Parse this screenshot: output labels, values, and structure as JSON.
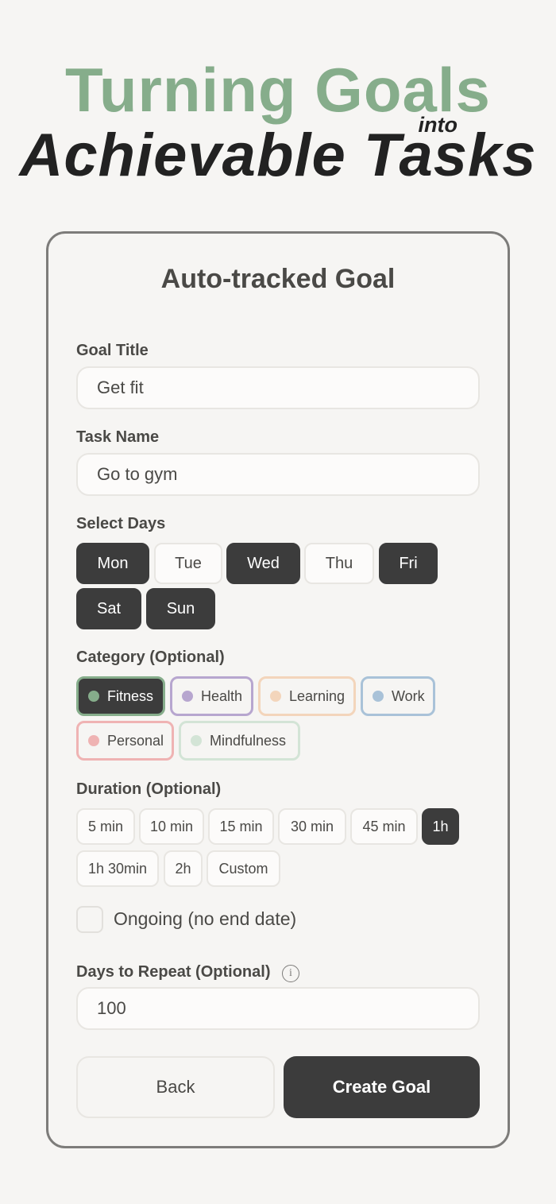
{
  "hero": {
    "line1": "Turning Goals",
    "into": "into",
    "line2": "Achievable Tasks"
  },
  "form": {
    "title": "Auto-tracked Goal",
    "goal_title": {
      "label": "Goal Title",
      "value": "Get fit"
    },
    "task_name": {
      "label": "Task Name",
      "value": "Go to gym"
    },
    "days": {
      "label": "Select Days",
      "items": [
        {
          "label": "Mon",
          "selected": true
        },
        {
          "label": "Tue",
          "selected": false
        },
        {
          "label": "Wed",
          "selected": true
        },
        {
          "label": "Thu",
          "selected": false
        },
        {
          "label": "Fri",
          "selected": true
        },
        {
          "label": "Sat",
          "selected": true
        },
        {
          "label": "Sun",
          "selected": true
        }
      ]
    },
    "category": {
      "label": "Category (Optional)",
      "items": [
        {
          "label": "Fitness",
          "color": "#86ad8b",
          "selected": true
        },
        {
          "label": "Health",
          "color": "#b7a6cf",
          "selected": false
        },
        {
          "label": "Learning",
          "color": "#f3d5bb",
          "selected": false
        },
        {
          "label": "Work",
          "color": "#a9c2d8",
          "selected": false
        },
        {
          "label": "Personal",
          "color": "#efb3b3",
          "selected": false
        },
        {
          "label": "Mindfulness",
          "color": "#d3e4d6",
          "selected": false
        }
      ]
    },
    "duration": {
      "label": "Duration (Optional)",
      "items": [
        {
          "label": "5 min",
          "selected": false
        },
        {
          "label": "10 min",
          "selected": false
        },
        {
          "label": "15 min",
          "selected": false
        },
        {
          "label": "30 min",
          "selected": false
        },
        {
          "label": "45 min",
          "selected": false
        },
        {
          "label": "1h",
          "selected": true
        },
        {
          "label": "1h 30min",
          "selected": false
        },
        {
          "label": "2h",
          "selected": false
        },
        {
          "label": "Custom",
          "selected": false
        }
      ]
    },
    "ongoing": {
      "label": "Ongoing (no end date)",
      "checked": false
    },
    "repeat": {
      "label": "Days to Repeat (Optional)",
      "info_icon": "i",
      "value": "100"
    },
    "buttons": {
      "back": "Back",
      "create": "Create Goal"
    }
  },
  "colors": {
    "accent_green": "#86ad8b",
    "dark": "#3c3c3c"
  }
}
